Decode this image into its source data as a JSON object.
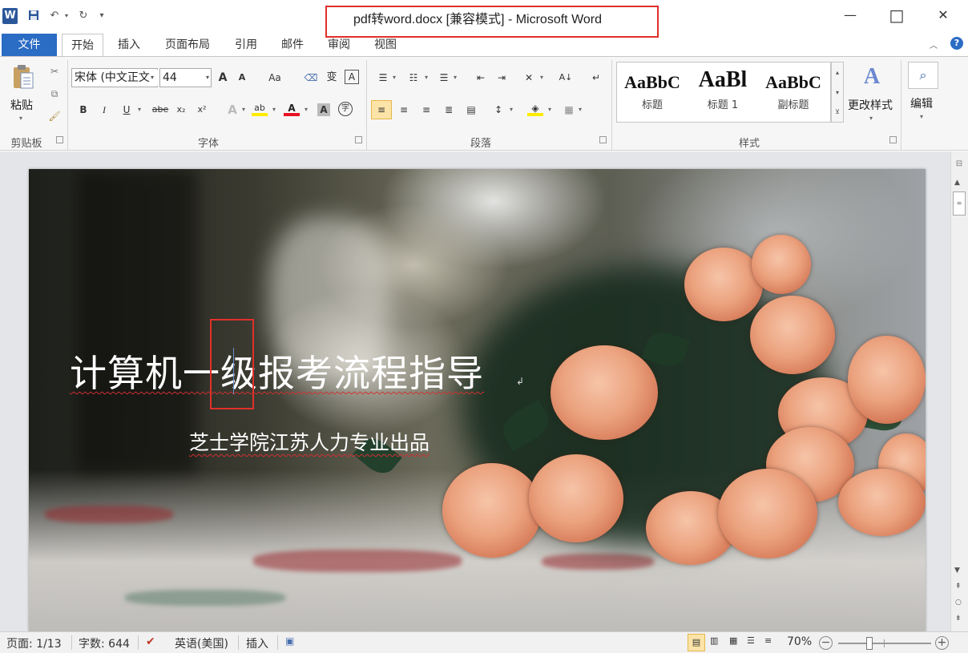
{
  "window": {
    "title": "pdf转word.docx [兼容模式] - Microsoft Word",
    "logo": "W"
  },
  "qat": {
    "save": "save-icon",
    "undo": "undo-icon",
    "redo": "redo-icon"
  },
  "window_controls": {
    "minimize": "—",
    "maximize": "□",
    "close": "✕"
  },
  "tabs": {
    "file": "文件",
    "home": "开始",
    "insert": "插入",
    "layout": "页面布局",
    "references": "引用",
    "mailings": "邮件",
    "review": "审阅",
    "view": "视图"
  },
  "ribbon": {
    "clipboard": {
      "paste": "粘贴",
      "label": "剪贴板"
    },
    "font": {
      "name": "宋体 (中文正文)",
      "size": "44",
      "label": "字体",
      "bold": "B",
      "italic": "I",
      "underline": "U",
      "strike": "abe",
      "sub": "x₂",
      "sup": "x²",
      "grow": "A",
      "shrink": "A",
      "aa": "Aa",
      "fontcolor": "A",
      "shade": "A",
      "circle": "字"
    },
    "paragraph": {
      "label": "段落"
    },
    "styles": {
      "label": "样式",
      "items": [
        {
          "sample": "AaBbC",
          "name": "标题"
        },
        {
          "sample": "AaBl",
          "name": "标题 1"
        },
        {
          "sample": "AaBbC",
          "name": "副标题"
        }
      ],
      "change": "更改样式"
    },
    "editing": {
      "label": "编辑"
    }
  },
  "document": {
    "title": "计算机一级报考流程指导",
    "subtitle": "芝士学院江苏人力专业出品"
  },
  "status": {
    "page": "页面: 1/13",
    "words": "字数: 644",
    "language": "英语(美国)",
    "mode": "插入",
    "zoom": "70%",
    "zoom_level": 0.7
  }
}
